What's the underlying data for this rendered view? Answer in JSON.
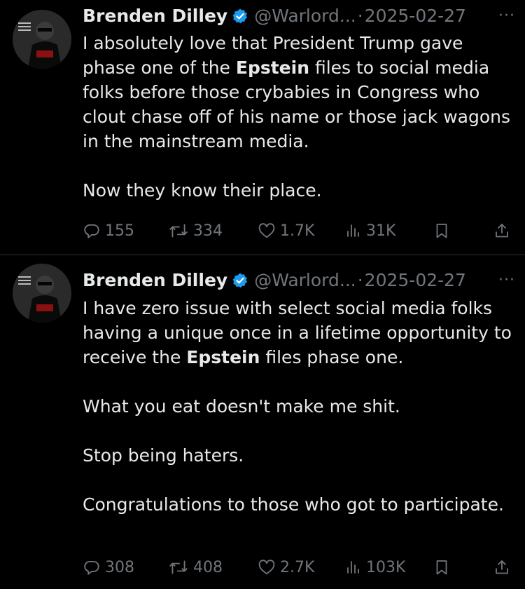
{
  "tweets": [
    {
      "author_name": "Brenden Dilley",
      "handle": "@Warlord...",
      "separator": "·",
      "date": "2025-02-27",
      "more_label": "···",
      "p1_before": "I absolutely love that President Trump gave phase one of the ",
      "p1_bold": "Epstein",
      "p1_after": " files to social media folks before those crybabies in Congress who clout chase off of his name or those jack wagons in the mainstream media.",
      "p2": "Now they know their place.",
      "replies": "155",
      "reposts": "334",
      "likes": "1.7K",
      "views": "31K"
    },
    {
      "author_name": "Brenden Dilley",
      "handle": "@Warlord...",
      "separator": "·",
      "date": "2025-02-27",
      "more_label": "···",
      "p1_before": "I have zero issue with select social media folks having a unique once in a lifetime opportunity to receive the ",
      "p1_bold": "Epstein",
      "p1_after": " files phase one.",
      "p2": "What you eat doesn't make me shit.",
      "p3": "Stop being haters.",
      "p4": "Congratulations to those who got to participate.",
      "replies": "308",
      "reposts": "408",
      "likes": "2.7K",
      "views": "103K"
    }
  ],
  "colors": {
    "background": "#000000",
    "text": "#e7e9ea",
    "muted": "#71767b",
    "verified_blue": "#1d9bf0",
    "divider": "#2f3336"
  },
  "icons": [
    "verified-badge-icon",
    "more-icon",
    "reply-icon",
    "repost-icon",
    "like-icon",
    "views-icon",
    "bookmark-icon",
    "share-icon"
  ]
}
